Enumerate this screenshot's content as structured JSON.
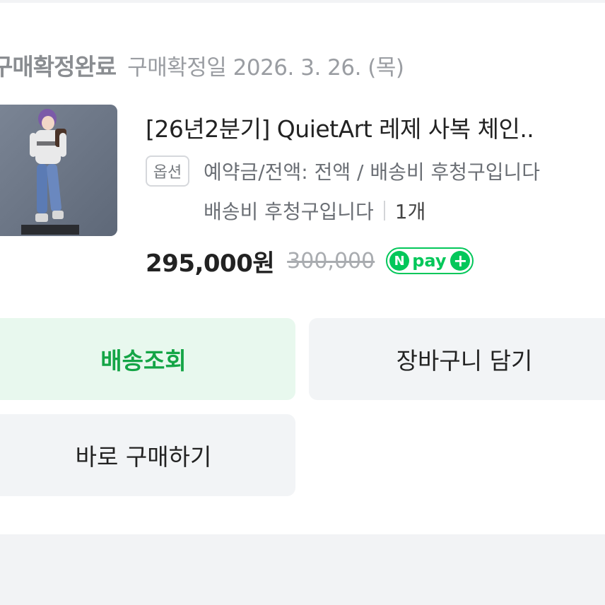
{
  "order": {
    "status": "구매확정완료",
    "confirm_date": "구매확정일 2026. 3. 26. (목)"
  },
  "product": {
    "title": "[26년2분기] QuietArt 레제 사복 체인..",
    "option_badge": "옵션",
    "option_line1": "예약금/전액: 전액 / 배송비 후청구입니다",
    "option_line2": "배송비 후청구입니다",
    "quantity": "1개",
    "price": "295,000원",
    "original_price": "300,000",
    "npay": {
      "n": "N",
      "text": "pay",
      "plus": "+"
    }
  },
  "buttons": {
    "track": "배송조회",
    "cart": "장바구니 담기",
    "buy_now": "바로 구매하기"
  },
  "colors": {
    "brand_green": "#03c75a",
    "track_text": "#14a546",
    "track_bg": "#e8f8ee",
    "button_bg": "#f2f4f6"
  }
}
